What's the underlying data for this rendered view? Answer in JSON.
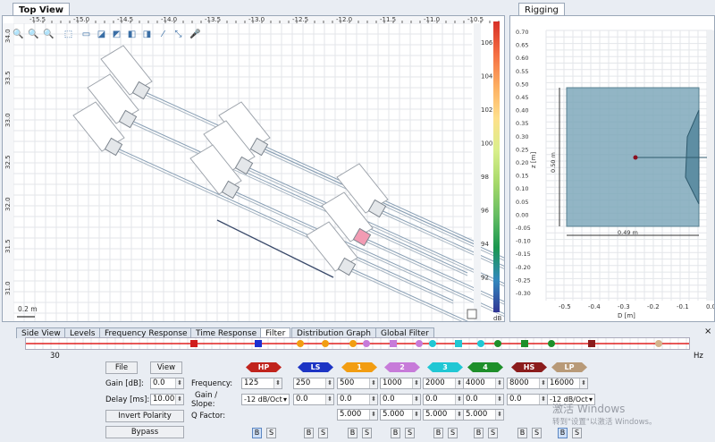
{
  "top_view": {
    "tab_label": "Top View",
    "x_ticks": [
      "-15.5",
      "-15.0",
      "-14.5",
      "-14.0",
      "-13.5",
      "-13.0",
      "-12.5",
      "-12.0",
      "-11.5",
      "-11.0",
      "-10.5"
    ],
    "y_ticks": [
      "34.0",
      "33.5",
      "33.0",
      "32.5",
      "32.0",
      "31.5",
      "31.0"
    ],
    "scale_label": "0.2 m",
    "colorbar": {
      "unit": "dB",
      "ticks": [
        "106",
        "104",
        "102",
        "100",
        "98",
        "96",
        "94",
        "92"
      ],
      "colors": [
        "#d73027",
        "#f46d43",
        "#fdae61",
        "#fee08b",
        "#d9ef8b",
        "#a6d96a",
        "#66bd63",
        "#1a9850",
        "#3288bd",
        "#313695"
      ]
    }
  },
  "rigging": {
    "tab_label": "Rigging",
    "y_ticks": [
      "0.70",
      "0.65",
      "0.60",
      "0.55",
      "0.50",
      "0.45",
      "0.40",
      "0.35",
      "0.30",
      "0.25",
      "0.20",
      "0.15",
      "0.10",
      "0.05",
      "0.00",
      "-0.05",
      "-0.10",
      "-0.15",
      "-0.20",
      "-0.25",
      "-0.30"
    ],
    "x_ticks": [
      "-0.5",
      "-0.4",
      "-0.3",
      "-0.2",
      "-0.1",
      "0.0"
    ],
    "y_axis_label": "z [m]",
    "x_axis_label": "D [m]",
    "height_label": "0.50 m",
    "width_label": "0.49 m"
  },
  "bottom_tabs": [
    {
      "label": "Side View",
      "active": false
    },
    {
      "label": "Levels",
      "active": false
    },
    {
      "label": "Frequency Response",
      "active": false
    },
    {
      "label": "Time Response",
      "active": false
    },
    {
      "label": "Filter",
      "active": true
    },
    {
      "label": "Distribution Graph",
      "active": false
    },
    {
      "label": "Global Filter",
      "active": false
    }
  ],
  "filter": {
    "freq_axis_start": "30",
    "freq_axis_unit": "Hz",
    "markers": [
      {
        "color": "#d01c1c",
        "shape": "square"
      },
      {
        "color": "#1c2ed0",
        "shape": "square"
      },
      {
        "color": "#f29d12",
        "shape": "circle"
      },
      {
        "color": "#f29d12",
        "shape": "circle"
      },
      {
        "color": "#f29d12",
        "shape": "circle"
      },
      {
        "color": "#c77bd9",
        "shape": "circle"
      },
      {
        "color": "#c77bd9",
        "shape": "square"
      },
      {
        "color": "#c77bd9",
        "shape": "circle"
      },
      {
        "color": "#20c7d4",
        "shape": "circle"
      },
      {
        "color": "#20c7d4",
        "shape": "square"
      },
      {
        "color": "#20c7d4",
        "shape": "circle"
      },
      {
        "color": "#1e8f2a",
        "shape": "circle"
      },
      {
        "color": "#1e8f2a",
        "shape": "square"
      },
      {
        "color": "#1e8f2a",
        "shape": "circle"
      },
      {
        "color": "#8b1c1c",
        "shape": "square"
      },
      {
        "color": "#d4b48c",
        "shape": "circle"
      }
    ],
    "file_button": "File",
    "view_button": "View",
    "gain_label": "Gain [dB]:",
    "gain_value": "0.0",
    "delay_label": "Delay [ms]:",
    "delay_value": "10.000",
    "invert_button": "Invert Polarity",
    "bypass_button": "Bypass",
    "frequency_label": "Frequency:",
    "gain_slope_label_1": "Gain /",
    "gain_slope_label_2": "Slope:",
    "q_label": "Q Factor:",
    "bands": [
      {
        "name": "HP",
        "color": "#c0231c",
        "frequency": "125",
        "gain": "-12 dB/Oct",
        "gain_is_select": true,
        "q": "",
        "b_on": true
      },
      {
        "name": "LS",
        "color": "#1c34c4",
        "frequency": "250",
        "gain": "0.0",
        "gain_is_select": false,
        "q": "",
        "b_on": false
      },
      {
        "name": "1",
        "color": "#f29d12",
        "frequency": "500",
        "gain": "0.0",
        "gain_is_select": false,
        "q": "5.000",
        "b_on": false
      },
      {
        "name": "2",
        "color": "#c77bd9",
        "frequency": "1000",
        "gain": "0.0",
        "gain_is_select": false,
        "q": "5.000",
        "b_on": false
      },
      {
        "name": "3",
        "color": "#20c7d4",
        "frequency": "2000",
        "gain": "0.0",
        "gain_is_select": false,
        "q": "5.000",
        "b_on": false
      },
      {
        "name": "4",
        "color": "#1e8f2a",
        "frequency": "4000",
        "gain": "0.0",
        "gain_is_select": false,
        "q": "5.000",
        "b_on": false
      },
      {
        "name": "HS",
        "color": "#8b1c1c",
        "frequency": "8000",
        "gain": "0.0",
        "gain_is_select": false,
        "q": "",
        "b_on": false
      },
      {
        "name": "LP",
        "color": "#b89a78",
        "frequency": "16000",
        "gain": "-12 dB/Oct",
        "gain_is_select": true,
        "q": "",
        "b_on": true
      }
    ],
    "b_label": "B",
    "s_label": "S"
  },
  "watermark": {
    "line1": "激活 Windows",
    "line2": "转到\"设置\"以激活 Windows。"
  }
}
